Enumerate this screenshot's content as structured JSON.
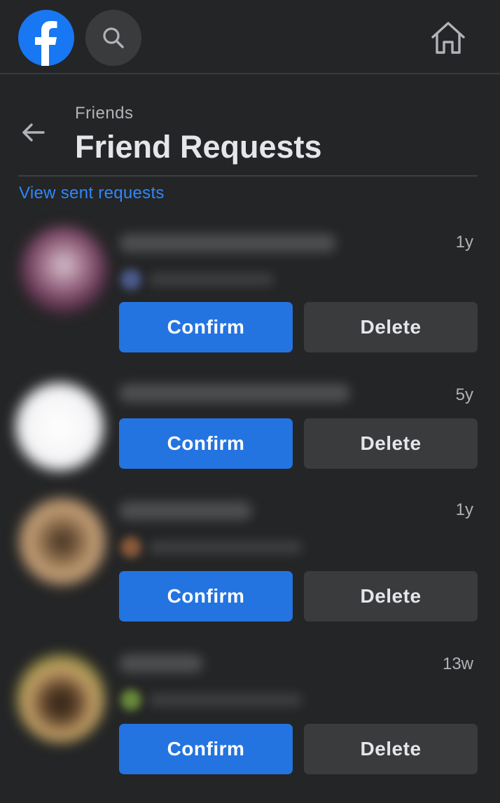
{
  "topbar": {
    "logo_icon": "facebook-logo-icon",
    "search_icon": "search-icon",
    "home_icon": "home-icon",
    "brand_color": "#1877f2"
  },
  "header": {
    "breadcrumb": "Friends",
    "title": "Friend Requests",
    "back_icon": "arrow-left-icon"
  },
  "sent_requests_link": "View sent requests",
  "requests": [
    {
      "time": "1y",
      "confirm_label": "Confirm",
      "delete_label": "Delete",
      "has_mutual": true
    },
    {
      "time": "5y",
      "confirm_label": "Confirm",
      "delete_label": "Delete",
      "has_mutual": false
    },
    {
      "time": "1y",
      "confirm_label": "Confirm",
      "delete_label": "Delete",
      "has_mutual": true
    },
    {
      "time": "13w",
      "confirm_label": "Confirm",
      "delete_label": "Delete",
      "has_mutual": true
    }
  ],
  "colors": {
    "background": "#242526",
    "confirm_button": "#2374e1",
    "delete_button": "#3a3b3c",
    "link": "#2d88ff"
  }
}
